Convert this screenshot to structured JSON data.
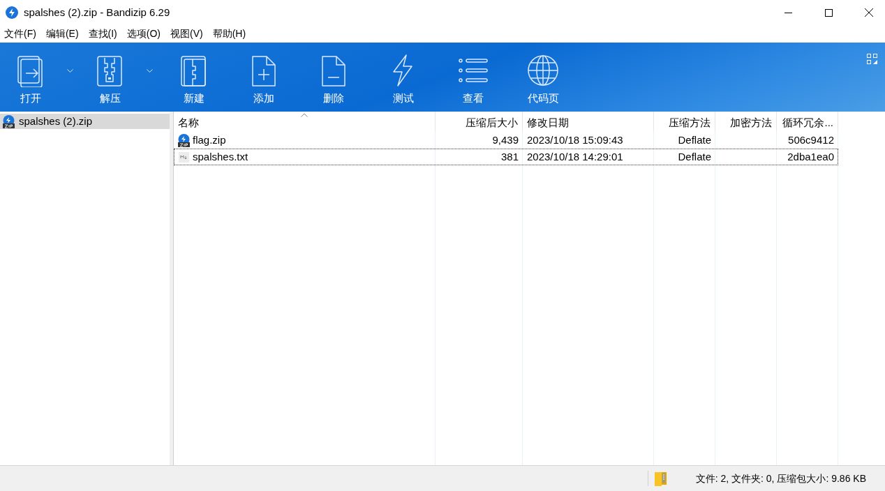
{
  "window": {
    "title": "spalshes (2).zip - Bandizip 6.29"
  },
  "menu": [
    "文件(F)",
    "编辑(E)",
    "查找(I)",
    "选项(O)",
    "视图(V)",
    "帮助(H)"
  ],
  "toolbar": [
    {
      "kind": "open",
      "label": "打开",
      "dropdown": true
    },
    {
      "kind": "extract",
      "label": "解压",
      "dropdown": true
    },
    {
      "kind": "new",
      "label": "新建",
      "dropdown": false
    },
    {
      "kind": "add",
      "label": "添加",
      "dropdown": false
    },
    {
      "kind": "delete",
      "label": "删除",
      "dropdown": false
    },
    {
      "kind": "test",
      "label": "测试",
      "dropdown": false
    },
    {
      "kind": "view",
      "label": "查看",
      "dropdown": false
    },
    {
      "kind": "codepage",
      "label": "代码页",
      "dropdown": false
    }
  ],
  "tree": [
    {
      "label": "spalshes (2).zip",
      "selected": true
    }
  ],
  "table": {
    "columns": [
      {
        "label": "名称",
        "sorted": true
      },
      {
        "label": "压缩后大小",
        "sorted": false
      },
      {
        "label": "修改日期",
        "sorted": false
      },
      {
        "label": "压缩方法",
        "sorted": false
      },
      {
        "label": "加密方法",
        "sorted": false
      },
      {
        "label": "循环冗余...",
        "sorted": false
      }
    ],
    "rows": [
      {
        "kind": "zip",
        "focused": false,
        "cells": [
          "flag.zip",
          "9,439",
          "2023/10/18 15:09:43",
          "Deflate",
          "",
          "506c9412"
        ]
      },
      {
        "kind": "text",
        "focused": true,
        "cells": [
          "spalshes.txt",
          "381",
          "2023/10/18 14:29:01",
          "Deflate",
          "",
          "2dba1ea0"
        ]
      }
    ]
  },
  "status_bar": {
    "text": "文件: 2, 文件夹: 0, 压缩包大小: 9.86 KB"
  }
}
